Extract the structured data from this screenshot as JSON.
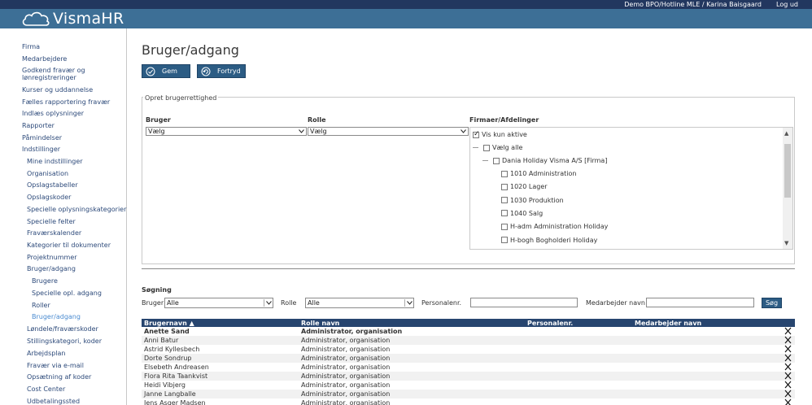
{
  "topbar": {
    "user": "Demo BPO/Hotline MLE / Karina Baisgaard",
    "logout": "Log ud"
  },
  "logo": {
    "text": "VismaHR",
    "icon": "cloud-icon"
  },
  "sidebar": {
    "items": [
      {
        "label": "Firma",
        "level": 1
      },
      {
        "label": "Medarbejdere",
        "level": 1
      },
      {
        "label": "Godkend fravær og",
        "level": 1
      },
      {
        "label": "lønregistreringer",
        "level": 1
      },
      {
        "label": "Kurser og uddannelse",
        "level": 1
      },
      {
        "label": "Fælles rapportering fravær",
        "level": 1
      },
      {
        "label": "Indlæs oplysninger",
        "level": 1
      },
      {
        "label": "Rapporter",
        "level": 1
      },
      {
        "label": "Påmindelser",
        "level": 1
      },
      {
        "label": "Indstillinger",
        "level": 1
      },
      {
        "label": "Mine indstillinger",
        "level": 2
      },
      {
        "label": "Organisation",
        "level": 2
      },
      {
        "label": "Opslagstabeller",
        "level": 2
      },
      {
        "label": "Opslagskoder",
        "level": 2
      },
      {
        "label": "Specielle oplysningskategorier",
        "level": 2
      },
      {
        "label": "Specielle felter",
        "level": 2
      },
      {
        "label": "Fraværskalender",
        "level": 2
      },
      {
        "label": "Kategorier til dokumenter",
        "level": 2
      },
      {
        "label": "Projektnummer",
        "level": 2
      },
      {
        "label": "Bruger/adgang",
        "level": 2
      },
      {
        "label": "Brugere",
        "level": 3
      },
      {
        "label": "Specielle opl. adgang",
        "level": 3
      },
      {
        "label": "Roller",
        "level": 3
      },
      {
        "label": "Bruger/adgang",
        "level": 3,
        "active": true
      },
      {
        "label": "Løndele/fraværskoder",
        "level": 2
      },
      {
        "label": "Stillingskategori, koder",
        "level": 2
      },
      {
        "label": "Arbejdsplan",
        "level": 2
      },
      {
        "label": "Fravær via e-mail",
        "level": 2
      },
      {
        "label": "Opsætning af koder",
        "level": 2
      },
      {
        "label": "Cost Center",
        "level": 2
      },
      {
        "label": "Udbetalingssted",
        "level": 2
      }
    ]
  },
  "page": {
    "title": "Bruger/adgang",
    "save_label": "Gem",
    "cancel_label": "Fortryd"
  },
  "form": {
    "legend": "Opret brugerrettighed",
    "user_label": "Bruger",
    "role_label": "Rolle",
    "firms_label": "Firmaer/Afdelinger",
    "user_value": "Vælg",
    "role_value": "Vælg",
    "tree": {
      "only_active": {
        "label": "Vis kun aktive",
        "checked": true
      },
      "select_all": "Vælg alle",
      "root": "Dania Holiday Visma A/S [Firma]",
      "children": [
        "1010 Administration",
        "1020 Lager",
        "1030 Produktion",
        "1040 Salg",
        "H-adm Administration Holiday",
        "H-bogh Bogholderi Holiday"
      ]
    }
  },
  "search": {
    "title": "Søgning",
    "user_label": "Bruger",
    "user_value": "Alle",
    "role_label": "Rolle",
    "role_value": "Alle",
    "personalnr_label": "Personalenr.",
    "employee_label": "Medarbejder navn",
    "button": "Søg"
  },
  "table": {
    "headers": {
      "username": "Brugernavn ▲",
      "role": "Rolle navn",
      "personalnr": "Personalenr.",
      "employee": "Medarbejder navn"
    },
    "rows": [
      {
        "name": "Anette Sand",
        "role": "Administrator, organisation"
      },
      {
        "name": "Anni Batur",
        "role": "Administrator, organisation"
      },
      {
        "name": "Astrid Kyllesbech",
        "role": "Administrator, organisation"
      },
      {
        "name": "Dorte Sondrup",
        "role": "Administrator, organisation"
      },
      {
        "name": "Elsebeth Andreasen",
        "role": "Administrator, organisation"
      },
      {
        "name": "Flora Rita Taankvist",
        "role": "Administrator, organisation"
      },
      {
        "name": "Heidi Vibjerg",
        "role": "Administrator, organisation"
      },
      {
        "name": "Janne Langballe",
        "role": "Administrator, organisation"
      },
      {
        "name": "Jens Asger Madsen",
        "role": "Administrator, organisation"
      }
    ]
  }
}
